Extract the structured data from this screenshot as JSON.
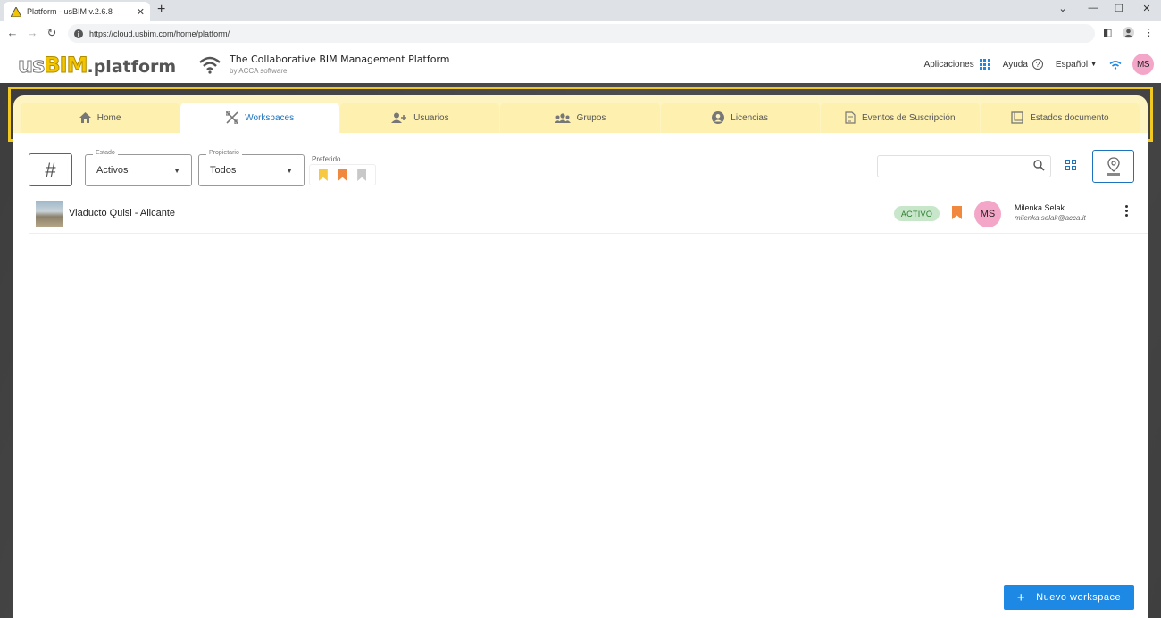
{
  "browser": {
    "tab_title": "Platform - usBIM v.2.6.8",
    "tab_close": "✕",
    "new_tab": "+",
    "url": "https://cloud.usbim.com/home/platform/",
    "window_controls": [
      "⌄",
      "—",
      "❐",
      "✕"
    ]
  },
  "header": {
    "logo_us": "us",
    "logo_bim": "BIM",
    "logo_platform": ".platform",
    "tagline": "The Collaborative BIM Management Platform",
    "byline": "by ACCA software",
    "apps_label": "Aplicaciones",
    "help_label": "Ayuda",
    "language": "Español",
    "user_initials": "MS"
  },
  "tabs": [
    {
      "label": "Home",
      "icon": "home-icon"
    },
    {
      "label": "Workspaces",
      "icon": "tools-icon",
      "active": true
    },
    {
      "label": "Usuarios",
      "icon": "user-add-icon"
    },
    {
      "label": "Grupos",
      "icon": "group-icon"
    },
    {
      "label": "Licencias",
      "icon": "account-circle-icon"
    },
    {
      "label": "Eventos de Suscripción",
      "icon": "document-event-icon"
    },
    {
      "label": "Estados documento",
      "icon": "document-state-icon"
    }
  ],
  "filters": {
    "hash_symbol": "#",
    "estado_label": "Estado",
    "estado_value": "Activos",
    "propietario_label": "Propietario",
    "propietario_value": "Todos",
    "preferido_label": "Preferido",
    "bookmark_colors": [
      "#f7c942",
      "#f0883e",
      "#c8c8c8"
    ]
  },
  "workspaces": [
    {
      "name": "Viaducto Quisi - Alicante",
      "status": "ACTIVO",
      "owner_initials": "MS",
      "owner_name": "Milenka Selak",
      "owner_email": "milenka.selak@acca.it"
    }
  ],
  "actions": {
    "new_workspace_plus": "+",
    "new_workspace": "Nuevo workspace"
  },
  "colors": {
    "accent": "#1e88e5",
    "tab_highlight": "#f2c921",
    "status_green": "#c8e6c9",
    "avatar_pink": "#f4a6c8"
  }
}
